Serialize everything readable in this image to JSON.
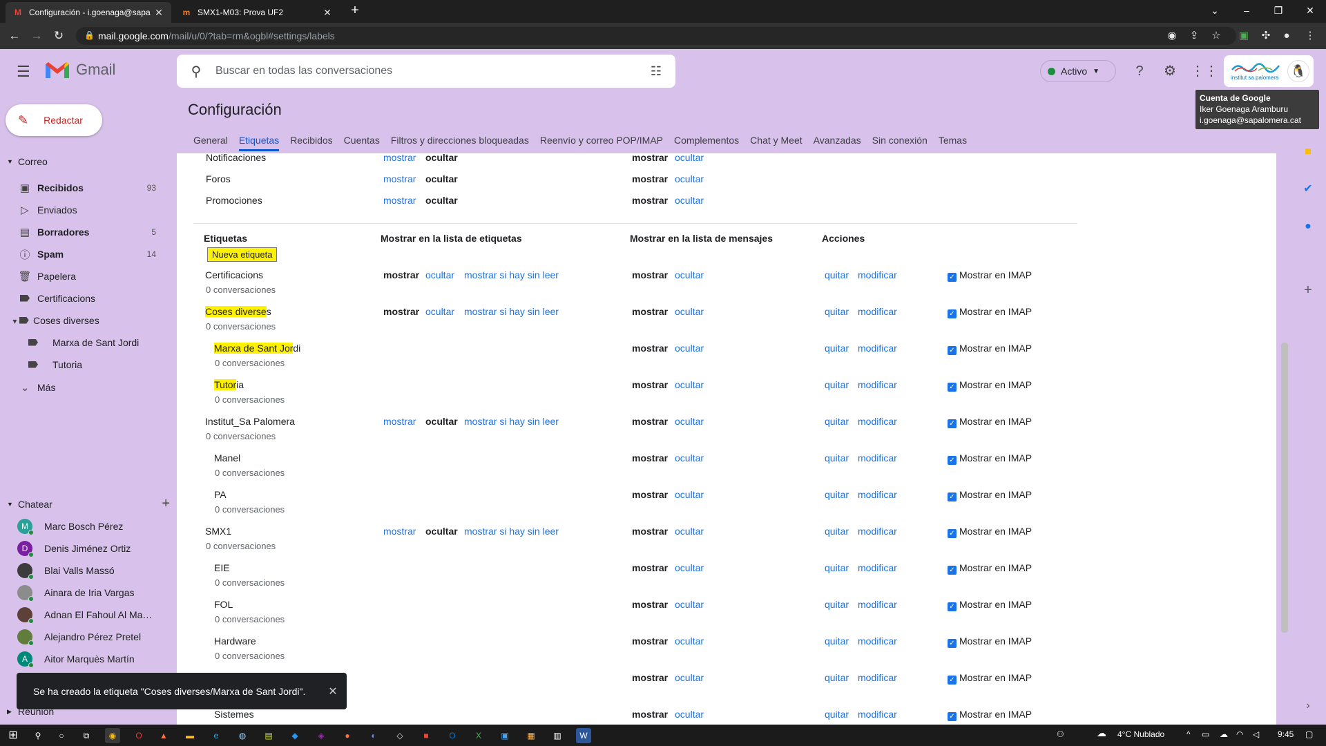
{
  "browser": {
    "tabs": [
      {
        "title": "Configuración - i.goenaga@sapa",
        "icon": "gmail-icon",
        "active": true
      },
      {
        "title": "SMX1-M03: Prova UF2",
        "icon": "moodle-icon",
        "active": false
      }
    ],
    "url_host": "mail.google.com",
    "url_path": "/mail/u/0/?tab=rm&ogbl#settings/labels"
  },
  "header": {
    "app_name": "Gmail",
    "search_placeholder": "Buscar en todas las conversaciones",
    "status_label": "Activo",
    "account_org": "institut sa palomera"
  },
  "tooltip": {
    "title": "Cuenta de Google",
    "name": "Iker Goenaga Aramburu",
    "email": "i.goenaga@sapalomera.cat"
  },
  "sidebar": {
    "compose_label": "Redactar",
    "mail_section": "Correo",
    "items": [
      {
        "label": "Recibidos",
        "count": "93",
        "icon": "inbox-icon",
        "bold": true,
        "active": true
      },
      {
        "label": "Enviados",
        "count": "",
        "icon": "send-icon",
        "bold": false
      },
      {
        "label": "Borradores",
        "count": "5",
        "icon": "draft-icon",
        "bold": true
      },
      {
        "label": "Spam",
        "count": "14",
        "icon": "spam-icon",
        "bold": true
      },
      {
        "label": "Papelera",
        "count": "",
        "icon": "trash-icon",
        "bold": false
      },
      {
        "label": "Certificacions",
        "count": "",
        "icon": "label-icon",
        "bold": false
      },
      {
        "label": "Coses diverses",
        "count": "",
        "icon": "label-icon",
        "bold": false
      },
      {
        "label": "Marxa de Sant Jordi",
        "count": "",
        "icon": "label-icon",
        "bold": false
      },
      {
        "label": "Tutoria",
        "count": "",
        "icon": "label-icon",
        "bold": false
      },
      {
        "label": "Más",
        "count": "",
        "icon": "chevron-down-icon",
        "bold": false
      }
    ],
    "chat_section": "Chatear",
    "chats": [
      {
        "name": "Marc Bosch Pérez",
        "initial": "M",
        "color": "#2aa198"
      },
      {
        "name": "Denis Jiménez Ortiz",
        "initial": "D",
        "color": "#7b1fa2"
      },
      {
        "name": "Blai Valls Massó",
        "initial": "",
        "color": "#3c3c3c"
      },
      {
        "name": "Ainara de Iria Vargas",
        "initial": "",
        "color": "#8c8c8c"
      },
      {
        "name": "Adnan El Fahoul Al Mak...",
        "initial": "",
        "color": "#5d4037"
      },
      {
        "name": "Alejandro Pérez Pretel",
        "initial": "",
        "color": "#607d3b"
      },
      {
        "name": "Aitor Marquès Martín",
        "initial": "A",
        "color": "#00897b"
      }
    ],
    "meet_section": "Reunión"
  },
  "settings": {
    "title": "Configuración",
    "tabs": [
      "General",
      "Etiquetas",
      "Recibidos",
      "Cuentas",
      "Filtros y direcciones bloqueadas",
      "Reenvío y correo POP/IMAP",
      "Complementos",
      "Chat y Meet",
      "Avanzadas",
      "Sin conexión",
      "Temas"
    ],
    "active_tab": "Etiquetas",
    "categories": [
      {
        "name": "Notificaciones",
        "show": "mostrar",
        "hide": "ocultar",
        "msg_show": "mostrar",
        "msg_hide": "ocultar"
      },
      {
        "name": "Foros",
        "show": "mostrar",
        "hide": "ocultar",
        "msg_show": "mostrar",
        "msg_hide": "ocultar"
      },
      {
        "name": "Promociones",
        "show": "mostrar",
        "hide": "ocultar",
        "msg_show": "mostrar",
        "msg_hide": "ocultar"
      }
    ],
    "col_labels": "Etiquetas",
    "col_list": "Mostrar en la lista de etiquetas",
    "col_messages": "Mostrar en la lista de mensajes",
    "col_actions": "Acciones",
    "new_label": "Nueva etiqueta",
    "labels": [
      {
        "name": "Certificacions",
        "convs": "0 conversaciones",
        "indent": false,
        "list": [
          "mostrar",
          "ocultar",
          "mostrar si hay sin leer"
        ],
        "list_bold": "mostrar",
        "hl": ""
      },
      {
        "name": "Coses diverses",
        "convs": "0 conversaciones",
        "indent": false,
        "list": [
          "mostrar",
          "ocultar",
          "mostrar si hay sin leer"
        ],
        "list_bold": "mostrar",
        "hl": "Coses diverse"
      },
      {
        "name": "Marxa de Sant Jordi",
        "convs": "0 conversaciones",
        "indent": true,
        "list": [],
        "list_bold": "",
        "hl": "Marxa de Sant Jor"
      },
      {
        "name": "Tutoria",
        "convs": "0 conversaciones",
        "indent": true,
        "list": [],
        "list_bold": "",
        "hl": "Tutor"
      },
      {
        "name": "Institut_Sa Palomera",
        "convs": "0 conversaciones",
        "indent": false,
        "list": [
          "mostrar",
          "ocultar",
          "mostrar si hay sin leer"
        ],
        "list_bold": "ocultar",
        "hl": ""
      },
      {
        "name": "Manel",
        "convs": "0 conversaciones",
        "indent": true,
        "list": [],
        "list_bold": "",
        "hl": ""
      },
      {
        "name": "PA",
        "convs": "0 conversaciones",
        "indent": true,
        "list": [],
        "list_bold": "",
        "hl": ""
      },
      {
        "name": "SMX1",
        "convs": "0 conversaciones",
        "indent": false,
        "list": [
          "mostrar",
          "ocultar",
          "mostrar si hay sin leer"
        ],
        "list_bold": "ocultar",
        "hl": ""
      },
      {
        "name": "EIE",
        "convs": "0 conversaciones",
        "indent": true,
        "list": [],
        "list_bold": "",
        "hl": ""
      },
      {
        "name": "FOL",
        "convs": "0 conversaciones",
        "indent": true,
        "list": [],
        "list_bold": "",
        "hl": ""
      },
      {
        "name": "Hardware",
        "convs": "0 conversaciones",
        "indent": true,
        "list": [],
        "list_bold": "",
        "hl": ""
      },
      {
        "name": "",
        "convs": "",
        "indent": true,
        "list": [],
        "list_bold": "",
        "hl": ""
      },
      {
        "name": "Sistemes",
        "convs": "",
        "indent": true,
        "list": [],
        "list_bold": "",
        "hl": ""
      }
    ],
    "msg_show": "mostrar",
    "msg_hide": "ocultar",
    "action_remove": "quitar",
    "action_edit": "modificar",
    "imap_label": "Mostrar en IMAP"
  },
  "toast": {
    "text": "Se ha creado la etiqueta \"Coses diverses/Marxa de Sant Jordi\"."
  },
  "taskbar": {
    "weather": "4°C  Nublado",
    "time": "9:45"
  }
}
